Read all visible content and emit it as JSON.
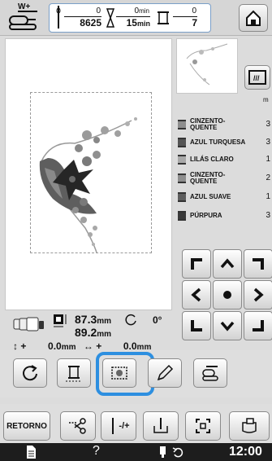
{
  "topbar": {
    "presser_label": "W+",
    "stitch_done": "0",
    "stitch_total": "8625",
    "time_done": "0",
    "time_unit_top": "min",
    "time_total": "15",
    "time_unit_bottom": "min",
    "color_done": "0",
    "color_total": "7"
  },
  "colors": [
    {
      "name_1": "CINZENTO-",
      "name_2": "QUENTE",
      "num": "3",
      "swatch": "#8e8e8e"
    },
    {
      "name_1": "AZUL TURQUESA",
      "name_2": "",
      "num": "3",
      "swatch": "#555555"
    },
    {
      "name_1": "LILÁS CLARO",
      "name_2": "",
      "num": "1",
      "swatch": "#a9a9a9"
    },
    {
      "name_1": "CINZENTO-",
      "name_2": "QUENTE",
      "num": "2",
      "swatch": "#8e8e8e"
    },
    {
      "name_1": "AZUL SUAVE",
      "name_2": "",
      "num": "1",
      "swatch": "#5e5e5e"
    },
    {
      "name_1": "PÚRPURA",
      "name_2": "",
      "num": "3",
      "swatch": "#3a3a3a"
    }
  ],
  "color_header": "m",
  "size": {
    "width": "87.3",
    "height": "89.2",
    "unit": "mm",
    "rotation": "0°",
    "offset_v": "0.0",
    "offset_h": "0.0",
    "plus": "+"
  },
  "bottom": {
    "retorno_label": "RETORNO",
    "minus_plus": "-/+",
    "help": "?",
    "clock": "12:00"
  }
}
